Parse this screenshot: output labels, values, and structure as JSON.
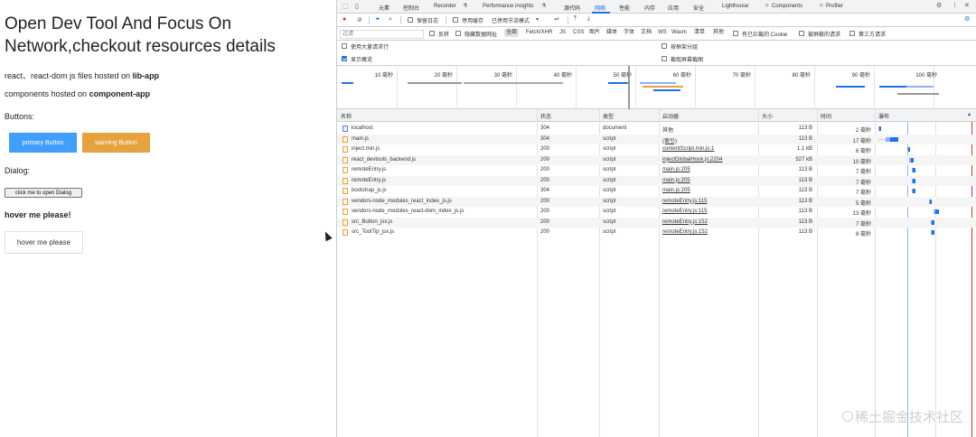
{
  "page": {
    "title": "Open Dev Tool And Focus On Network,checkout resources details",
    "line1_prefix": "react、react-dom js files hosted on ",
    "line1_bold": "lib-app",
    "line2_prefix": "components hosted on ",
    "line2_bold": "component-app",
    "buttons_heading": "Buttons:",
    "primary_button": "primary Button",
    "warning_button": "warning Button",
    "dialog_heading": "Dialog:",
    "dialog_button": "click me to open Dialog",
    "hover_heading": "hover me please!",
    "hover_button": "hover me please",
    "colors": {
      "primary": "#409eff",
      "warning": "#e6a23c"
    }
  },
  "devtools": {
    "tabs": [
      "元素",
      "控制台",
      "Recorder",
      "Performance insights",
      "源代码",
      "网络",
      "性能",
      "内存",
      "应用",
      "安全",
      "Lighthouse",
      "Components",
      "Profiler"
    ],
    "active_tab": "网络",
    "toolbar": {
      "preserve_log": "保留日志",
      "disable_cache": "停用缓存",
      "throttling": "已停用节流模式"
    },
    "filter": {
      "placeholder": "过滤",
      "invert": "反转",
      "hide_data_urls": "隐藏数据网址",
      "types": [
        "全部",
        "Fetch/XHR",
        "JS",
        "CSS",
        "图片",
        "媒体",
        "字体",
        "文档",
        "WS",
        "Wasm",
        "清单",
        "其他"
      ],
      "selected_type": "全部",
      "blocked_cookies": "有已拦截的 Cookie",
      "blocked_requests": "被屏蔽的请求",
      "third_party": "第三方请求"
    },
    "options": {
      "big_rows": "使用大量请求行",
      "group_by_frame": "按框架分组",
      "show_overview": "显示概览",
      "capture_screenshots": "截取屏幕截图"
    },
    "timeline_ticks": [
      "10 毫秒",
      "20 毫秒",
      "30 毫秒",
      "40 毫秒",
      "50 毫秒",
      "60 毫秒",
      "70 毫秒",
      "80 毫秒",
      "90 毫秒",
      "100 毫秒"
    ],
    "columns": {
      "name": "名称",
      "status": "状态",
      "type": "类型",
      "initiator": "启动器",
      "size": "大小",
      "time": "时间",
      "waterfall": "瀑布"
    },
    "rows": [
      {
        "name": "localhost",
        "status": "304",
        "type": "document",
        "initiator": "其他",
        "size": "113 B",
        "time": "2 毫秒",
        "icon": "doc",
        "link": false
      },
      {
        "name": "main.js",
        "status": "304",
        "type": "script",
        "initiator": "(索引)",
        "size": "113 B",
        "time": "17 毫秒",
        "icon": "js",
        "link": true
      },
      {
        "name": "inject.min.js",
        "status": "200",
        "type": "script",
        "initiator": "contentScript.min.js:1",
        "size": "1.1 kB",
        "time": "6 毫秒",
        "icon": "js",
        "link": true
      },
      {
        "name": "react_devtools_backend.js",
        "status": "200",
        "type": "script",
        "initiator": "injectGlobalHook.js:2204",
        "size": "527 kB",
        "time": "10 毫秒",
        "icon": "js",
        "link": true
      },
      {
        "name": "remoteEntry.js",
        "status": "200",
        "type": "script",
        "initiator": "main.js:205",
        "size": "113 B",
        "time": "7 毫秒",
        "icon": "js",
        "link": true
      },
      {
        "name": "remoteEntry.js",
        "status": "200",
        "type": "script",
        "initiator": "main.js:205",
        "size": "113 B",
        "time": "7 毫秒",
        "icon": "js",
        "link": true
      },
      {
        "name": "bootstrap_js.js",
        "status": "304",
        "type": "script",
        "initiator": "main.js:205",
        "size": "113 B",
        "time": "7 毫秒",
        "icon": "js",
        "link": true
      },
      {
        "name": "vendors-node_modules_react_index_js.js",
        "status": "200",
        "type": "script",
        "initiator": "remoteEntry.js:115",
        "size": "113 B",
        "time": "5 毫秒",
        "icon": "js",
        "link": true
      },
      {
        "name": "vendors-node_modules_react-dom_index_js.js",
        "status": "200",
        "type": "script",
        "initiator": "remoteEntry.js:115",
        "size": "113 B",
        "time": "13 毫秒",
        "icon": "js",
        "link": true
      },
      {
        "name": "src_Button_jsx.js",
        "status": "200",
        "type": "script",
        "initiator": "remoteEntry.js:152",
        "size": "113 B",
        "time": "7 毫秒",
        "icon": "js",
        "link": true
      },
      {
        "name": "src_ToolTip_jsx.js",
        "status": "200",
        "type": "script",
        "initiator": "remoteEntry.js:152",
        "size": "113 B",
        "time": "8 毫秒",
        "icon": "js",
        "link": true
      }
    ]
  },
  "watermark": "稀土掘金技术社区"
}
